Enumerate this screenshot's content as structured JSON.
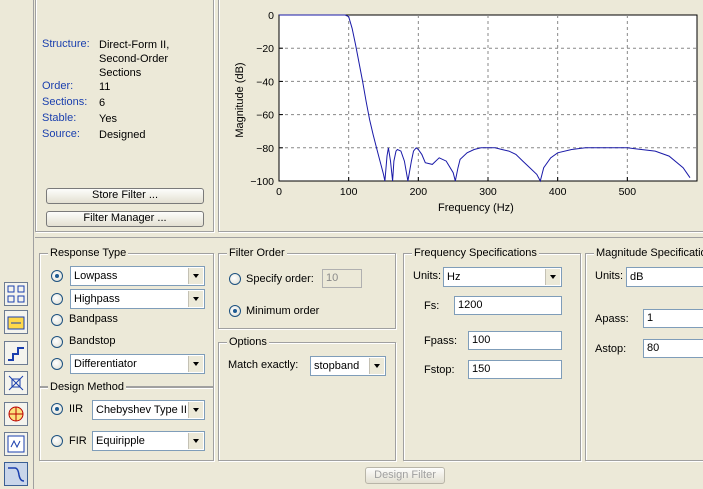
{
  "info": {
    "rows": [
      {
        "label": "Structure:",
        "value": "Direct-Form II,\nSecond-Order\nSections"
      },
      {
        "label": "Order:",
        "value": "11"
      },
      {
        "label": "Sections:",
        "value": "6"
      },
      {
        "label": "Stable:",
        "value": "Yes"
      },
      {
        "label": "Source:",
        "value": "Designed"
      }
    ],
    "store_filter_label": "Store Filter ...",
    "filter_manager_label": "Filter Manager ..."
  },
  "plot": {
    "ylabel": "Magnitude (dB)",
    "xlabel": "Frequency (Hz)",
    "yticks": [
      "0",
      "−20",
      "−40",
      "−60",
      "−80",
      "−100"
    ],
    "xticks": [
      "0",
      "100",
      "200",
      "300",
      "400",
      "500"
    ],
    "line_color": "#1a1aa8"
  },
  "chart_data": {
    "type": "line",
    "xlabel": "Frequency (Hz)",
    "ylabel": "Magnitude (dB)",
    "xlim": [
      0,
      600
    ],
    "ylim": [
      -100,
      0
    ],
    "grid": true,
    "series": [
      {
        "x": [
          0,
          10,
          20,
          30,
          40,
          50,
          60,
          70,
          80,
          90,
          95,
          100,
          105,
          110,
          115,
          120,
          125,
          130,
          135,
          140,
          145,
          150,
          152,
          155,
          157,
          160,
          163,
          165,
          168,
          170,
          175,
          180,
          185,
          190,
          193,
          197,
          200,
          205,
          210,
          220,
          230,
          240,
          250,
          253,
          257,
          260,
          270,
          280,
          290,
          300,
          310,
          320,
          330,
          340,
          350,
          360,
          370,
          375,
          380,
          390,
          400,
          420,
          440,
          460,
          480,
          500,
          520,
          540,
          560,
          580,
          590
        ],
        "y": [
          0,
          0,
          0,
          0,
          0,
          0,
          0,
          0,
          0,
          0,
          0,
          -1,
          -8,
          -18,
          -29,
          -40,
          -52,
          -63,
          -72,
          -80,
          -88,
          -96,
          -100,
          -85,
          -80,
          -88,
          -100,
          -88,
          -82,
          -81,
          -82,
          -88,
          -100,
          -88,
          -82,
          -80,
          -81,
          -84,
          -89,
          -90,
          -86,
          -88,
          -95,
          -100,
          -92,
          -87,
          -83,
          -81,
          -80,
          -80,
          -80,
          -81,
          -82,
          -84,
          -88,
          -92,
          -96,
          -100,
          -92,
          -86,
          -83,
          -81,
          -80,
          -80,
          -80,
          -80,
          -81,
          -82,
          -85,
          -92,
          -98
        ]
      }
    ]
  },
  "response_type": {
    "title": "Response Type",
    "options": [
      {
        "label": "Lowpass",
        "selected": true,
        "has_combo": true
      },
      {
        "label": "Highpass",
        "selected": false,
        "has_combo": true
      },
      {
        "label": "Bandpass",
        "selected": false,
        "has_combo": false
      },
      {
        "label": "Bandstop",
        "selected": false,
        "has_combo": false
      },
      {
        "label": "Differentiator",
        "selected": false,
        "has_combo": true
      }
    ]
  },
  "design_method": {
    "title": "Design Method",
    "iir_label": "IIR",
    "iir_value": "Chebyshev Type II",
    "fir_label": "FIR",
    "fir_value": "Equiripple"
  },
  "filter_order": {
    "title": "Filter Order",
    "specify_label": "Specify order:",
    "specify_value": "10",
    "minimum_label": "Minimum order"
  },
  "options": {
    "title": "Options",
    "match_label": "Match exactly:",
    "match_value": "stopband"
  },
  "freq_spec": {
    "title": "Frequency Specifications",
    "units_label": "Units:",
    "units_value": "Hz",
    "fs_label": "Fs:",
    "fs_value": "1200",
    "fpass_label": "Fpass:",
    "fpass_value": "100",
    "fstop_label": "Fstop:",
    "fstop_value": "150"
  },
  "mag_spec": {
    "title": "Magnitude Specifications",
    "units_label": "Units:",
    "units_value": "dB",
    "apass_label": "Apass:",
    "apass_value": "1",
    "astop_label": "Astop:",
    "astop_value": "80"
  },
  "design_filter_label": "Design Filter",
  "toolbar": {
    "icons": [
      "pole-zero-editor-icon",
      "transform-filter-icon",
      "realize-model-icon",
      "import-filter-icon",
      "design-filter-tool-icon",
      "multirate-icon",
      "filter-design-icon"
    ]
  }
}
